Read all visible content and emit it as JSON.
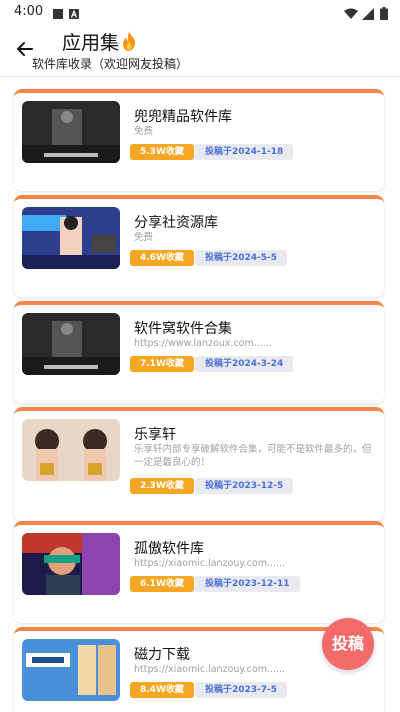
{
  "status": {
    "time": "4:00"
  },
  "header": {
    "title": "应用集",
    "title_icon": "fire-icon",
    "subtitle": "软件库收录（欢迎网友投稿）"
  },
  "colors": {
    "accent": "#f5874d",
    "fav_badge": "#f5a623",
    "date_text": "#4a6fd6",
    "fab": "#f26a6a"
  },
  "items": [
    {
      "name": "兜兜精品软件库",
      "desc": "免费",
      "favorites": "5.3W收藏",
      "date": "投稿于2024-1-18"
    },
    {
      "name": "分享社资源库",
      "desc": "免费",
      "favorites": "4.6W收藏",
      "date": "投稿于2024-5-5"
    },
    {
      "name": "软件窝软件合集",
      "desc": "https://www.lanzoux.com......",
      "favorites": "7.1W收藏",
      "date": "投稿于2024-3-24"
    },
    {
      "name": "乐享轩",
      "desc": "乐享轩内部专享破解软件合集，可能不是软件最多的，但一定是最良心的！",
      "favorites": "2.3W收藏",
      "date": "投稿于2023-12-5"
    },
    {
      "name": "孤傲软件库",
      "desc": "https://xiaomic.lanzouy.com......",
      "favorites": "6.1W收藏",
      "date": "投稿于2023-12-11"
    },
    {
      "name": "磁力下载",
      "desc": "https://xiaomic.lanzouy.com......",
      "favorites": "8.4W收藏",
      "date": "投稿于2023-7-5"
    }
  ],
  "fab": {
    "label": "投稿"
  }
}
